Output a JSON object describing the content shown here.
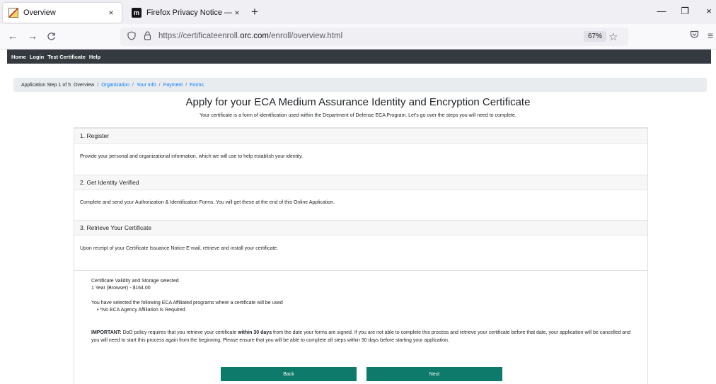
{
  "browser": {
    "tabs": [
      {
        "title": "Overview",
        "close": "×"
      },
      {
        "title": "Firefox Privacy Notice — Mozill",
        "close": "×"
      }
    ],
    "new_tab": "+",
    "window_controls": {
      "minimize": "—",
      "restore": "❐",
      "close": "×"
    },
    "nav": {
      "back": "←",
      "forward": "→",
      "reload": "C"
    },
    "url_prefix": "https://certificateenroll.",
    "url_domain": "orc.com",
    "url_path": "/enroll/overview.html",
    "zoom": "67%",
    "icons": {
      "shield": "shield-icon",
      "lock": "lock-icon",
      "star": "star-icon",
      "pocket": "pocket-icon",
      "menu": "hamburger-menu-icon"
    }
  },
  "site_nav": [
    "Home",
    "Login",
    "Test Certificate",
    "Help"
  ],
  "breadcrumb": {
    "prefix": "Application Step 1 of 5",
    "items": [
      "Overview",
      "Organization",
      "Your Info",
      "Payment",
      "Forms"
    ]
  },
  "page": {
    "title": "Apply for your ECA  Medium Assurance Identity and Encryption Certificate",
    "subtitle": "Your certificate is a form of identification used within the Department of Defense ECA Program. Let's go over the steps you will need to complete."
  },
  "steps": [
    {
      "heading": "1. Register",
      "body": "Provide your personal and organizational information, which we will use to help establish your identity."
    },
    {
      "heading": "2. Get Identity Verified",
      "body": "Complete and send your Authorization & Identification Forms. You will get these at the end of this Online Application."
    },
    {
      "heading": "3. Retrieve Your Certificate",
      "body": "Upon receipt of your Certificate Issuance Notice E-mail, retrieve and install your certificate."
    }
  ],
  "summary": {
    "validity_label": "Certificate Validity and Storage selected",
    "validity_value": "1 Year (Browser) - $164.00",
    "programs_label": "You have selected the following ECA Affiliated programs where a certificate will be used",
    "programs_item": "• *No ECA Agency Affiliation Is Required",
    "important_label": "IMPORTANT:",
    "important_pre": " DoD policy requires that you retrieve your certificate ",
    "important_bold": "within 30 days",
    "important_post": "  from the date your forms are signed. If you are not able to complete this process and retrieve your certificate  before that date, your application will be cancelled and you will need to start this process again from the beginning.  Please ensure that you will be able to complete all steps within 30 days before starting your application."
  },
  "buttons": {
    "back": "Back",
    "next": "Next"
  },
  "colors": {
    "primary_button": "#0d7a6b",
    "link": "#007bff",
    "navbar": "#343a40"
  }
}
